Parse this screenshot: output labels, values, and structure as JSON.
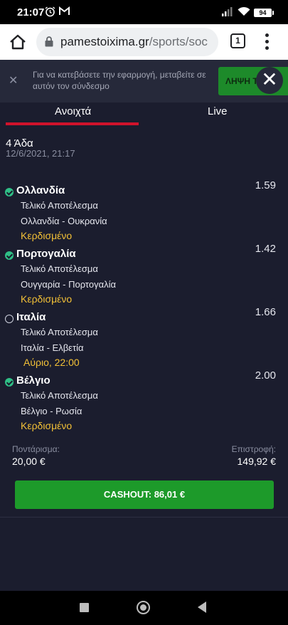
{
  "status_bar": {
    "time": "21:07",
    "battery": "94",
    "icons": [
      "alarm-icon",
      "gmail-icon",
      "signal-icon",
      "wifi-icon",
      "battery-icon"
    ]
  },
  "browser": {
    "domain": "pamestoixima.gr",
    "path": "/sports/soc",
    "tab_count": "1"
  },
  "banner": {
    "text": "Για να κατεβάσετε την εφαρμογή, μεταβείτε σε αυτόν τον σύνδεσμο",
    "button_label": "ΛΗΨΗ ΤΗ",
    "close": "✕",
    "close_big": "✕"
  },
  "tabs": [
    {
      "label": "Ανοιχτά",
      "active": true
    },
    {
      "label": "Live",
      "active": false
    }
  ],
  "bet": {
    "type": "4 Άδα",
    "date": "12/6/2021, 21:17",
    "selections": [
      {
        "team": "Ολλανδία",
        "odds": "1.59",
        "market": "Τελικό Αποτέλεσμα",
        "match": "Ολλανδία - Ουκρανία",
        "result": "Κερδισμένο",
        "status": "won"
      },
      {
        "team": "Πορτογαλία",
        "odds": "1.42",
        "market": "Τελικό Αποτέλεσμα",
        "match": "Ουγγαρία - Πορτογαλία",
        "result": "Κερδισμένο",
        "status": "won"
      },
      {
        "team": "Ιταλία",
        "odds": "1.66",
        "market": "Τελικό Αποτέλεσμα",
        "match": "Ιταλία - Ελβετία",
        "result": "Αύριο, 22:00",
        "status": "open"
      },
      {
        "team": "Βέλγιο",
        "odds": "2.00",
        "market": "Τελικό Αποτέλεσμα",
        "match": "Βέλγιο - Ρωσία",
        "result": "Κερδισμένο",
        "status": "won"
      }
    ],
    "stake_label": "Ποντάρισμα:",
    "stake_value": "20,00 €",
    "return_label": "Επιστροφή:",
    "return_value": "149,92 €",
    "cashout_label": "CASHOUT: 86,01 €"
  },
  "colors": {
    "background": "#1b1d2e",
    "accent_red": "#d0132b",
    "cashout_green": "#1d9a2a",
    "won_green": "#2fbf86",
    "result_yellow": "#f2c037"
  }
}
